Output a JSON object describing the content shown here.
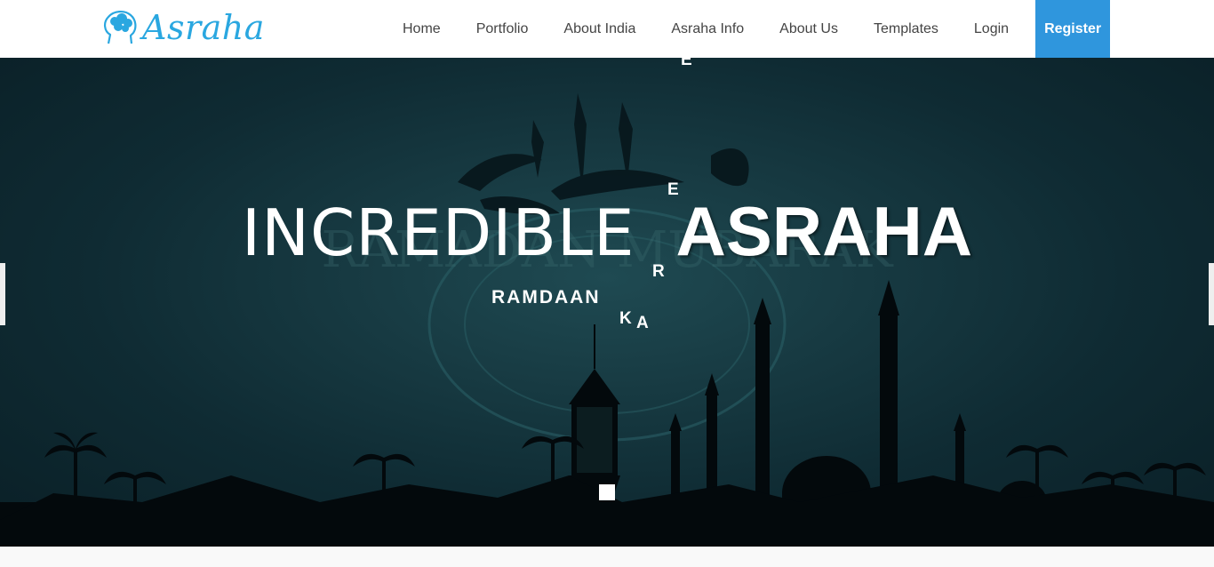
{
  "brand": {
    "name": "Asraha"
  },
  "nav": {
    "items": [
      "Home",
      "Portfolio",
      "About India",
      "Asraha Info",
      "About Us",
      "Templates",
      "Login"
    ],
    "register": "Register"
  },
  "hero": {
    "headline_light": "INCREDIBLE",
    "headline_bold": "ASRAHA",
    "sub_word": "RAMDAAN",
    "floating_letters": [
      "E",
      "E",
      "R",
      "K",
      "A"
    ],
    "background_text": "RAMADAN MUBARAK"
  },
  "slider": {
    "active_dot": 1,
    "dot_count": 1
  },
  "colors": {
    "brand": "#2aa7e0",
    "register_bg": "#2f96dd",
    "hero_bg": "#173a42"
  }
}
